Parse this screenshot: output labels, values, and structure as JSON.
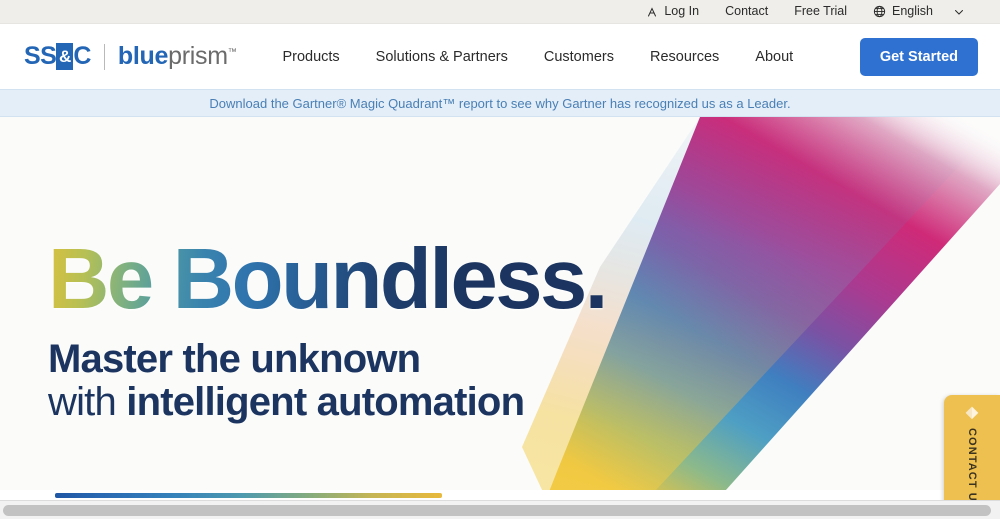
{
  "utility_bar": {
    "items": [
      {
        "label": "Log In",
        "icon": "account-person-icon"
      },
      {
        "label": "Contact",
        "icon": ""
      },
      {
        "label": "Free Trial",
        "icon": ""
      },
      {
        "label": "English",
        "icon": "globe-icon",
        "chevron": "chevron-down-icon"
      }
    ]
  },
  "header": {
    "logo": {
      "primary_left": "SS",
      "primary_amp": "&",
      "primary_right": "C",
      "secondary_blue": "blue",
      "secondary_prism": "prism",
      "trademark": "™"
    },
    "nav": [
      {
        "label": "Products"
      },
      {
        "label": "Solutions & Partners"
      },
      {
        "label": "Customers"
      },
      {
        "label": "Resources"
      },
      {
        "label": "About"
      }
    ],
    "cta_label": "Get Started"
  },
  "promo_banner": {
    "text": "Download the Gartner® Magic Quadrant™ report to see why Gartner has recognized us as a Leader."
  },
  "hero": {
    "headline": "Be Boundless.",
    "subhead_line1_bold": "Master the unknown",
    "subhead_line2_light": "with ",
    "subhead_line2_bold": "intelligent automation"
  },
  "contact_tab": {
    "label": "CONTACT US",
    "icon": "diamond-icon"
  },
  "colors": {
    "brand_blue": "#2466b6",
    "cta_blue": "#2f71d0",
    "utility_bar_bg": "#efeeea",
    "promo_bg": "#e3eef8",
    "promo_text": "#4a7fb5",
    "hero_bg": "#fbfbfa",
    "headline_navy": "#1b3560",
    "contact_tab_bg": "#eec04f"
  }
}
